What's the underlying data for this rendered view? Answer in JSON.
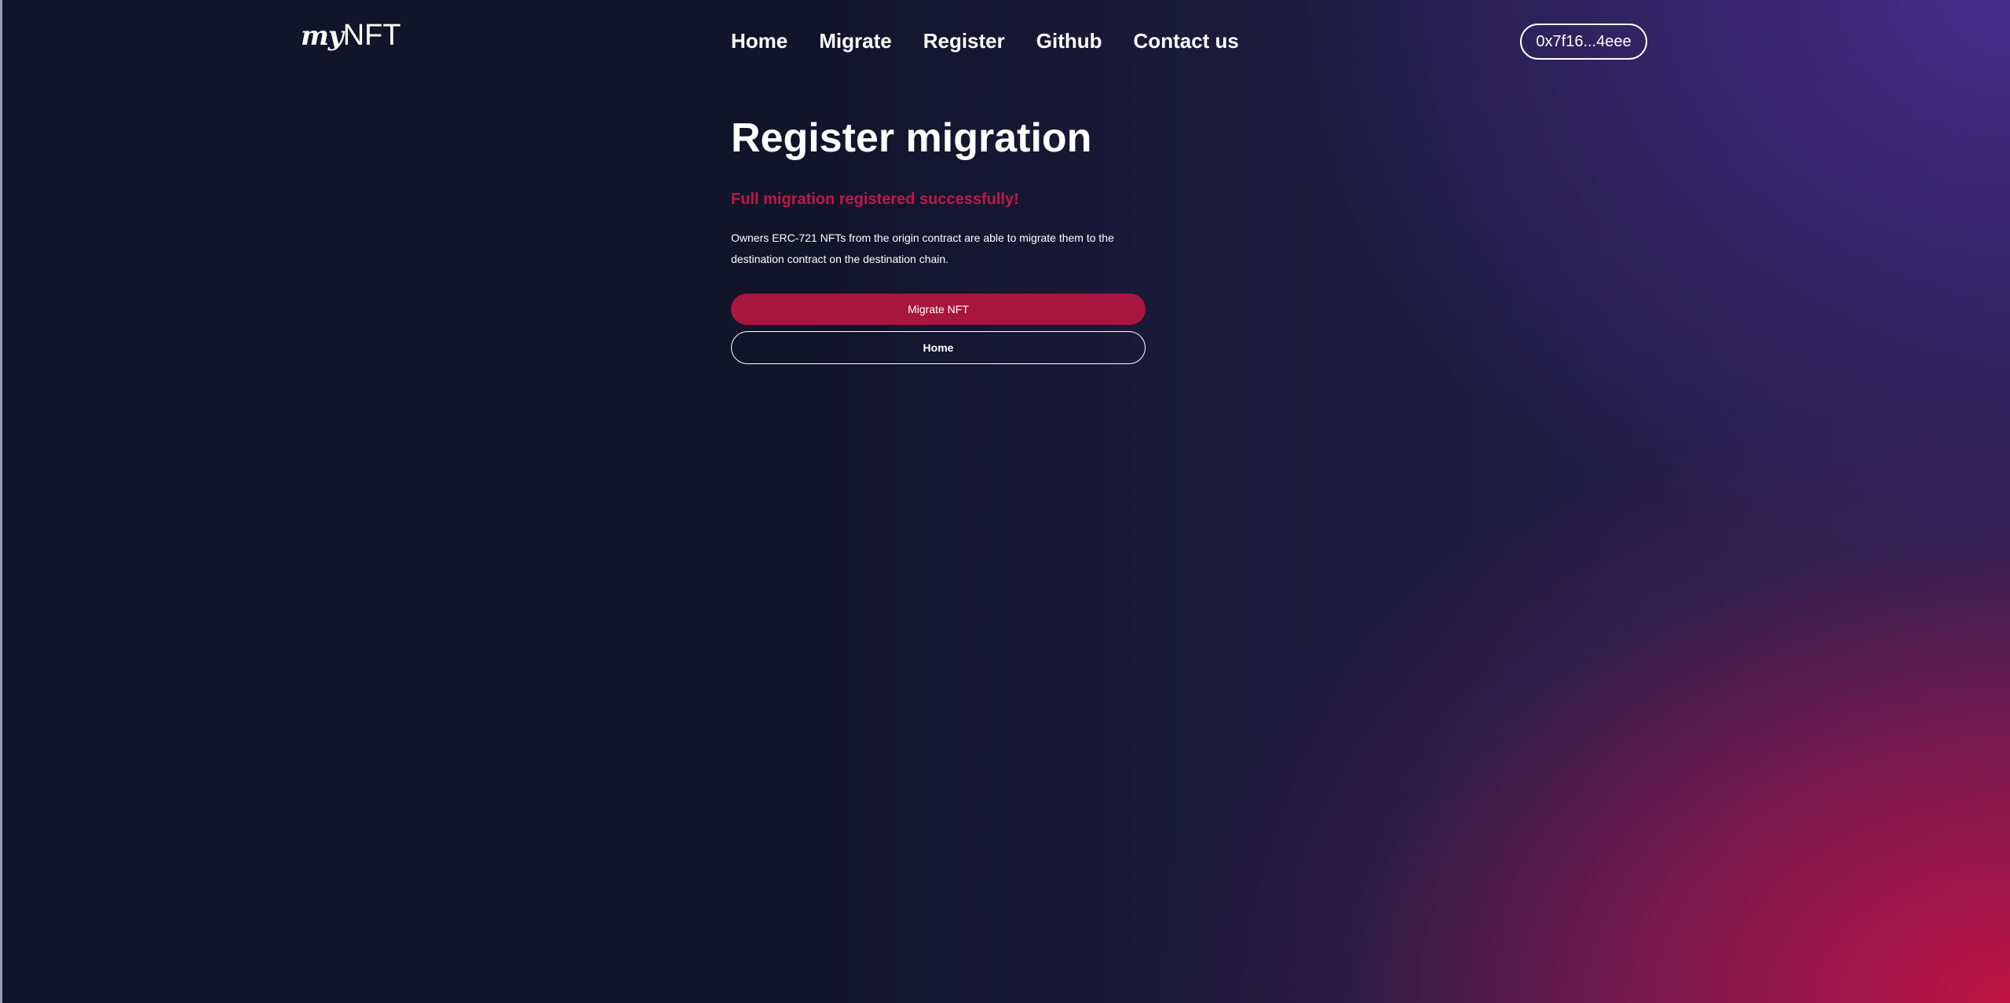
{
  "header": {
    "logo_prefix": "my",
    "logo_suffix": "NFT",
    "nav": [
      {
        "label": "Home"
      },
      {
        "label": "Migrate"
      },
      {
        "label": "Register"
      },
      {
        "label": "Github"
      },
      {
        "label": "Contact us"
      }
    ],
    "wallet_address": "0x7f16...4eee"
  },
  "main": {
    "title": "Register migration",
    "success_message": "Full migration registered successfully!",
    "description": "Owners ERC-721 NFTs from the origin contract are able to migrate them to the destination contract on the destination chain.",
    "primary_button": "Migrate NFT",
    "secondary_button": "Home"
  },
  "colors": {
    "accent": "#a8163f",
    "success_text": "#c0184a",
    "background_dark": "#12142a",
    "gradient_purple": "#482c8c",
    "gradient_red": "#c81244"
  }
}
